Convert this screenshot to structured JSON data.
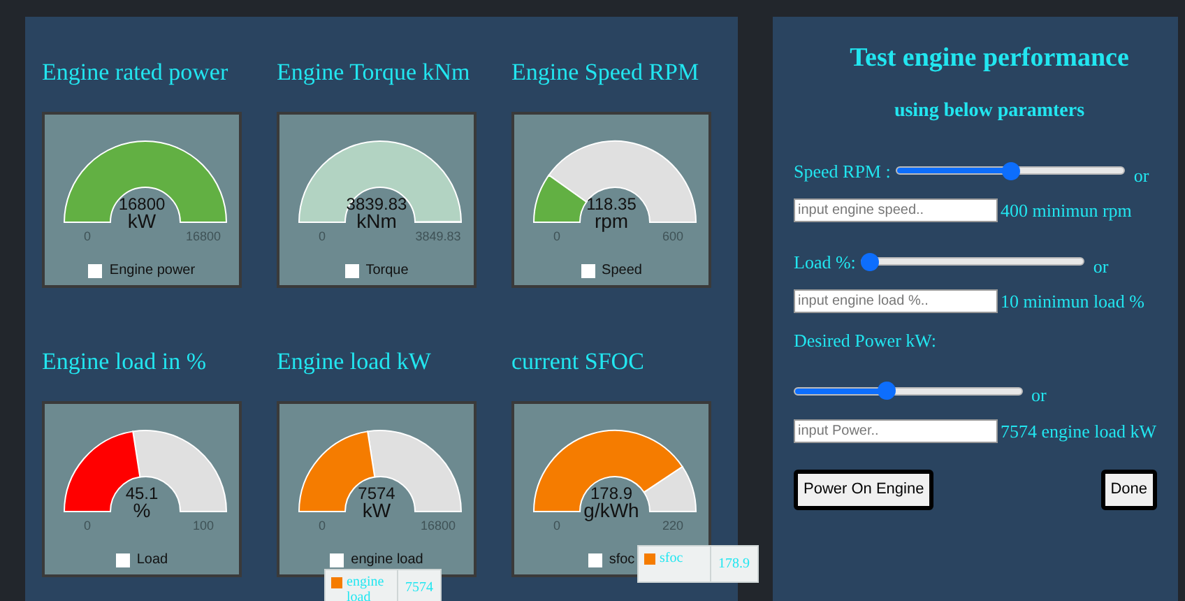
{
  "gauges": [
    {
      "title": "Engine rated power",
      "value": "16800",
      "unit": "kW",
      "min": "0",
      "max": "16800",
      "color": "#62b043",
      "legend": "Engine power",
      "checked": false
    },
    {
      "title": "Engine Torque kNm",
      "value": "3839.83",
      "unit": "kNm",
      "min": "0",
      "max": "3849.83",
      "color": "#b2d3c2",
      "legend": "Torque",
      "checked": false
    },
    {
      "title": "Engine Speed RPM",
      "value": "118.35",
      "unit": "rpm",
      "min": "0",
      "max": "600",
      "color": "#62b043",
      "legend": "Speed",
      "checked": false
    },
    {
      "title": "Engine load in %",
      "value": "45.1",
      "unit": "%",
      "min": "0",
      "max": "100",
      "color": "#ff0000",
      "legend": "Load",
      "checked": false
    },
    {
      "title": "Engine load kW",
      "value": "7574",
      "unit": "kW",
      "min": "0",
      "max": "16800",
      "color": "#f57c00",
      "legend": "engine load",
      "checked": false,
      "tooltip": {
        "label": "engine load",
        "value": "7574"
      }
    },
    {
      "title": "current SFOC",
      "value": "178.9",
      "unit": "g/kWh",
      "min": "0",
      "max": "220",
      "color": "#f57c00",
      "legend": "sfoc",
      "checked": false,
      "tooltip": {
        "label": "sfoc",
        "value": "178.9"
      }
    }
  ],
  "panel": {
    "title": "Test engine performance",
    "subtitle": "using below paramters",
    "controls": [
      {
        "kind": "slider",
        "label": "Speed RPM :",
        "level": 0.5,
        "suffix": "or"
      },
      {
        "kind": "field",
        "placeholder": "input engine speed..",
        "note": "400 minimun rpm"
      },
      {
        "kind": "slider",
        "label": "Load %:",
        "level": 0,
        "suffix": "or"
      },
      {
        "kind": "field",
        "placeholder": "input engine load %..",
        "note": "10 minimun load %"
      },
      {
        "kind": "label",
        "label": "Desired Power kW:"
      },
      {
        "kind": "slider",
        "level": 0.4,
        "suffix": "or"
      },
      {
        "kind": "field",
        "placeholder": "input Power..",
        "note": "7574 engine load kW"
      }
    ],
    "buttons": [
      "Power On Engine",
      "Done"
    ]
  }
}
